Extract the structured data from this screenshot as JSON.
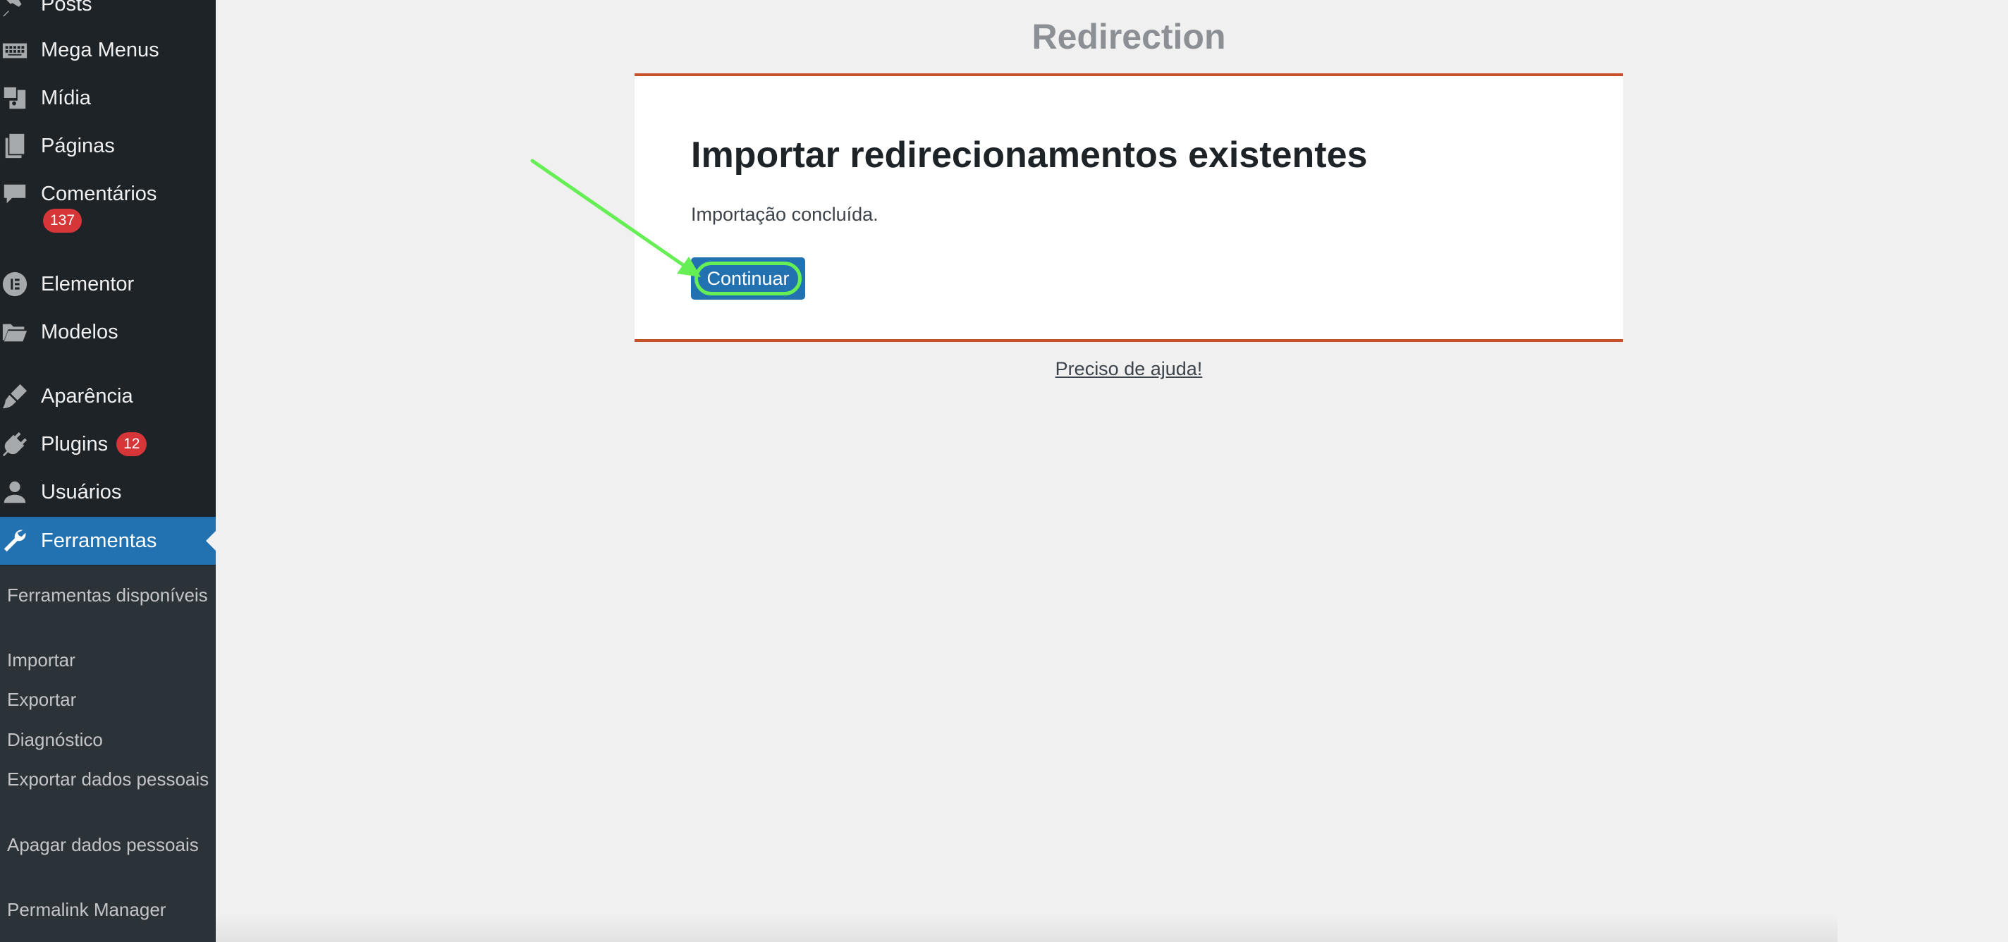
{
  "sidebar": {
    "items": [
      {
        "label": "Posts",
        "icon": "pin-icon"
      },
      {
        "label": "Mega Menus",
        "icon": "keyboard-icon"
      },
      {
        "label": "Mídia",
        "icon": "media-icon"
      },
      {
        "label": "Páginas",
        "icon": "pages-icon"
      },
      {
        "label": "Comentários",
        "icon": "comment-icon",
        "badge": "137"
      },
      {
        "label": "Elementor",
        "icon": "elementor-icon"
      },
      {
        "label": "Modelos",
        "icon": "folder-icon"
      },
      {
        "label": "Aparência",
        "icon": "brush-icon"
      },
      {
        "label": "Plugins",
        "icon": "plug-icon",
        "badge": "12"
      },
      {
        "label": "Usuários",
        "icon": "user-icon"
      },
      {
        "label": "Ferramentas",
        "icon": "wrench-icon",
        "active": true
      }
    ],
    "submenu": [
      "Ferramentas disponíveis",
      "Importar",
      "Exportar",
      "Diagnóstico",
      "Exportar dados pessoais",
      "Apagar dados pessoais",
      "Permalink Manager"
    ]
  },
  "main": {
    "title": "Redirection",
    "card": {
      "heading": "Importar redirecionamentos existentes",
      "message": "Importação concluída.",
      "button_label": "Continuar"
    },
    "help_link": "Preciso de ajuda!"
  },
  "colors": {
    "sidebar_bg": "#1d2327",
    "submenu_bg": "#2c3338",
    "accent": "#2271b1",
    "card_border": "#c9502d",
    "badge": "#d63638",
    "annotation": "#66ee55"
  }
}
